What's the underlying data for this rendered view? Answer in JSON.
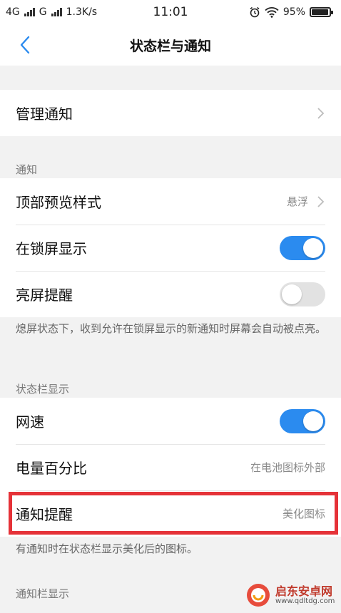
{
  "status_bar": {
    "sim1": "4G",
    "sim2": "G",
    "speed": "1.3K/s",
    "time": "11:01",
    "battery": "95%",
    "battery_level": 0.95
  },
  "header": {
    "title": "状态栏与通知"
  },
  "manage": {
    "label": "管理通知"
  },
  "notify_section": {
    "title": "通知",
    "items": [
      {
        "label": "顶部预览样式",
        "value": "悬浮"
      },
      {
        "label": "在锁屏显示",
        "on": true
      },
      {
        "label": "亮屏提醒",
        "on": false
      }
    ],
    "description": "熄屏状态下，收到允许在锁屏显示的新通知时屏幕会自动被点亮。"
  },
  "statusbar_section": {
    "title": "状态栏显示",
    "items": [
      {
        "label": "网速",
        "on": true
      },
      {
        "label": "电量百分比",
        "value": "在电池图标外部"
      },
      {
        "label": "通知提醒",
        "value": "美化图标"
      }
    ],
    "description": "有通知时在状态栏显示美化后的图标。"
  },
  "notifybar_section": {
    "title": "通知栏显示"
  },
  "watermark": {
    "name": "启东安卓网",
    "url": "www.qdltdg.com"
  },
  "colors": {
    "accent": "#2b8bef",
    "highlight": "#e53238"
  }
}
